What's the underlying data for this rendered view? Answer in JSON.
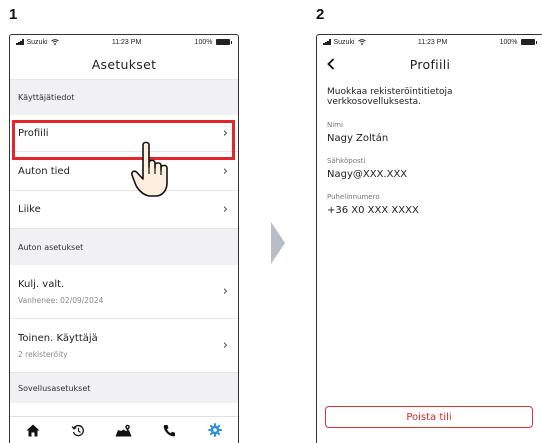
{
  "steps": {
    "one": "1",
    "two": "2"
  },
  "status_bar": {
    "carrier": "Suzuki",
    "time": "11:23 PM",
    "battery": "100%"
  },
  "screen1": {
    "title": "Asetukset",
    "section_user": "Käyttäjätiedot",
    "items_user": [
      {
        "label": "Profiili"
      },
      {
        "label": "Auton tied"
      },
      {
        "label": "Liike"
      }
    ],
    "section_car": "Auton asetukset",
    "items_car": [
      {
        "label": "Kulj. valt.",
        "sub": "Vanhenee: 02/09/2024"
      },
      {
        "label": "Toinen. Käyttäjä",
        "sub": "2 rekisteröity"
      }
    ],
    "section_app": "Sovellusasetukset",
    "tabs": [
      "home-icon",
      "history-icon",
      "map-icon",
      "phone-icon",
      "settings-icon"
    ],
    "accent_color": "#2b90d9",
    "highlight_color": "#e3262b"
  },
  "screen2": {
    "title": "Profiili",
    "description": "Muokkaa rekisteröintitietoja verkkosovelluksesta.",
    "fields": [
      {
        "label": "Nimi",
        "value": "Nagy Zoltán"
      },
      {
        "label": "Sähköposti",
        "value": "Nagy@XXX.XXX"
      },
      {
        "label": "Puhelinnumero",
        "value": "+36 X0 XXX XXXX"
      }
    ],
    "delete_button": "Poista tili"
  }
}
